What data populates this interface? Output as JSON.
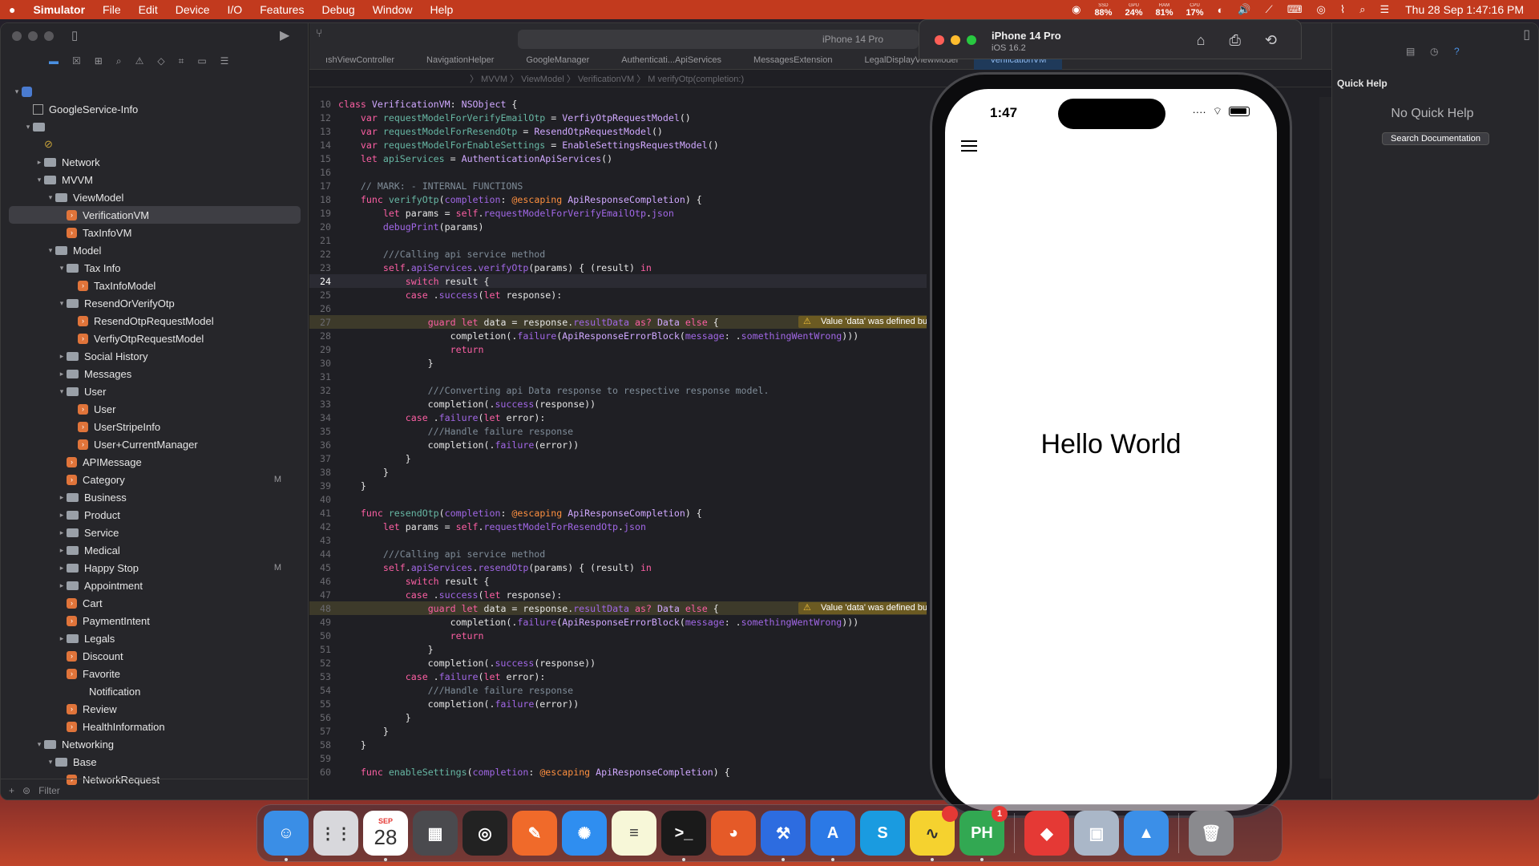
{
  "menubar": {
    "apple": "",
    "app": "Simulator",
    "items": [
      "File",
      "Edit",
      "Device",
      "I/O",
      "Features",
      "Debug",
      "Window",
      "Help"
    ],
    "stats": [
      {
        "label": "SSD",
        "value": "88%"
      },
      {
        "label": "GPU",
        "value": "24%"
      },
      {
        "label": "RAM",
        "value": "81%"
      },
      {
        "label": "CPU",
        "value": "17%"
      }
    ],
    "datetime": "Thu 28 Sep  1:47:16 PM"
  },
  "navigator": {
    "filter_placeholder": "Filter",
    "items": [
      {
        "label": "GoogleService-Info",
        "depth": 1,
        "kind": "plist"
      },
      {
        "label": "",
        "depth": 1,
        "kind": "folder",
        "open": true
      },
      {
        "label": "",
        "depth": 2,
        "kind": "other"
      },
      {
        "label": "Network",
        "depth": 2,
        "kind": "folder",
        "open": false
      },
      {
        "label": "MVVM",
        "depth": 2,
        "kind": "folder",
        "open": true
      },
      {
        "label": "ViewModel",
        "depth": 3,
        "kind": "folder",
        "open": true
      },
      {
        "label": "VerificationVM",
        "depth": 4,
        "kind": "swift",
        "selected": true
      },
      {
        "label": "TaxInfoVM",
        "depth": 4,
        "kind": "swift"
      },
      {
        "label": "Model",
        "depth": 3,
        "kind": "folder",
        "open": true
      },
      {
        "label": "Tax Info",
        "depth": 4,
        "kind": "folder",
        "open": true
      },
      {
        "label": "TaxInfoModel",
        "depth": 5,
        "kind": "swift"
      },
      {
        "label": "ResendOrVerifyOtp",
        "depth": 4,
        "kind": "folder",
        "open": true
      },
      {
        "label": "ResendOtpRequestModel",
        "depth": 5,
        "kind": "swift"
      },
      {
        "label": "VerfiyOtpRequestModel",
        "depth": 5,
        "kind": "swift"
      },
      {
        "label": "Social History",
        "depth": 4,
        "kind": "folder",
        "open": false
      },
      {
        "label": "Messages",
        "depth": 4,
        "kind": "folder",
        "open": false
      },
      {
        "label": "User",
        "depth": 4,
        "kind": "folder",
        "open": true
      },
      {
        "label": "User",
        "depth": 5,
        "kind": "swift"
      },
      {
        "label": "UserStripeInfo",
        "depth": 5,
        "kind": "swift"
      },
      {
        "label": "User+CurrentManager",
        "depth": 5,
        "kind": "swift"
      },
      {
        "label": "APIMessage",
        "depth": 4,
        "kind": "swift"
      },
      {
        "label": "Category",
        "depth": 4,
        "kind": "swift",
        "mark": "M"
      },
      {
        "label": "Business",
        "depth": 4,
        "kind": "folder",
        "open": false
      },
      {
        "label": "Product",
        "depth": 4,
        "kind": "folder",
        "open": false
      },
      {
        "label": "Service",
        "depth": 4,
        "kind": "folder",
        "open": false
      },
      {
        "label": "Medical",
        "depth": 4,
        "kind": "folder",
        "open": false
      },
      {
        "label": "Happy Stop",
        "depth": 4,
        "kind": "folder",
        "open": false,
        "mark": "M"
      },
      {
        "label": "Appointment",
        "depth": 4,
        "kind": "folder",
        "open": false
      },
      {
        "label": "Cart",
        "depth": 4,
        "kind": "swift"
      },
      {
        "label": "PaymentIntent",
        "depth": 4,
        "kind": "swift"
      },
      {
        "label": "Legals",
        "depth": 4,
        "kind": "folder",
        "open": false
      },
      {
        "label": "Discount",
        "depth": 4,
        "kind": "swift"
      },
      {
        "label": "Favorite",
        "depth": 4,
        "kind": "swift"
      },
      {
        "label": "Notification",
        "depth": 6,
        "kind": "none"
      },
      {
        "label": "Review",
        "depth": 4,
        "kind": "swift"
      },
      {
        "label": "HealthInformation",
        "depth": 4,
        "kind": "swift"
      },
      {
        "label": "Networking",
        "depth": 2,
        "kind": "folder",
        "open": true
      },
      {
        "label": "Base",
        "depth": 3,
        "kind": "folder",
        "open": true
      },
      {
        "label": "NetworkRequest",
        "depth": 4,
        "kind": "swift"
      }
    ]
  },
  "editor": {
    "scheme": "iPhone 14 Pro",
    "tabs": [
      "ıshViewController",
      "NavigationHelper",
      "GoogleManager",
      "Authenticati...ApiServices",
      "MessagesExtension",
      "LegalDisplayViewModel",
      "VerificationVM"
    ],
    "jumpbar": "〉 MVVM  〉 ViewModel  〉 VerificationVM  〉 M  verifyOtp(completion:)",
    "warning": "Value 'data' was defined but never used",
    "lines": [
      {
        "n": "10",
        "html": "<span class='kw'>class</span> <span class='ty'>VerificationVM</span><span class='pl'>: </span><span class='ty'>NSObject</span><span class='pl'> {</span>"
      },
      {
        "n": "12",
        "html": "<span class='pl'>    </span><span class='kw'>var</span><span class='pl'> </span><span class='id'>requestModelForVerifyEmailOtp</span><span class='pl'> = </span><span class='ty'>VerfiyOtpRequestModel</span><span class='pl'>()</span>"
      },
      {
        "n": "13",
        "html": "<span class='pl'>    </span><span class='kw'>var</span><span class='pl'> </span><span class='id'>requestModelForResendOtp</span><span class='pl'> = </span><span class='ty'>ResendOtpRequestModel</span><span class='pl'>()</span>"
      },
      {
        "n": "14",
        "html": "<span class='pl'>    </span><span class='kw'>var</span><span class='pl'> </span><span class='id'>requestModelForEnableSettings</span><span class='pl'> = </span><span class='ty'>EnableSettingsRequestModel</span><span class='pl'>()</span>"
      },
      {
        "n": "15",
        "html": "<span class='pl'>    </span><span class='kw'>let</span><span class='pl'> </span><span class='id'>apiServices</span><span class='pl'> = </span><span class='ty'>AuthenticationApiServices</span><span class='pl'>()</span>"
      },
      {
        "n": "16",
        "html": ""
      },
      {
        "n": "17",
        "html": "<span class='cm'>    // MARK: - INTERNAL FUNCTIONS</span>"
      },
      {
        "n": "18",
        "html": "<span class='pl'>    </span><span class='kw'>func</span><span class='pl'> </span><span class='id'>verifyOtp</span><span class='pl'>(</span><span class='fn'>completion</span><span class='pl'>: </span><span class='at'>@escaping</span><span class='pl'> </span><span class='ty'>ApiResponseCompletion</span><span class='pl'>) {</span>"
      },
      {
        "n": "19",
        "html": "<span class='pl'>        </span><span class='kw'>let</span><span class='pl'> params = </span><span class='kw'>self</span><span class='pl'>.</span><span class='fn'>requestModelForVerifyEmailOtp</span><span class='pl'>.</span><span class='fn'>json</span>"
      },
      {
        "n": "20",
        "html": "<span class='pl'>        </span><span class='fn'>debugPrint</span><span class='pl'>(params)</span>"
      },
      {
        "n": "21",
        "html": ""
      },
      {
        "n": "22",
        "html": "<span class='cm'>        ///Calling api service method</span>"
      },
      {
        "n": "23",
        "html": "<span class='pl'>        </span><span class='kw'>self</span><span class='pl'>.</span><span class='fn'>apiServices</span><span class='pl'>.</span><span class='fn'>verifyOtp</span><span class='pl'>(params) { (result) </span><span class='kw'>in</span>"
      },
      {
        "n": "24",
        "cur": true,
        "html": "<span class='pl'>            </span><span class='kw'>switch</span><span class='pl'> result {</span>"
      },
      {
        "n": "25",
        "html": "<span class='pl'>            </span><span class='kw'>case</span><span class='pl'> .</span><span class='fn'>success</span><span class='pl'>(</span><span class='kw'>let</span><span class='pl'> response):</span>"
      },
      {
        "n": "26",
        "html": ""
      },
      {
        "n": "27",
        "warn": true,
        "html": "<span class='pl'>                </span><span class='kw'>guard</span><span class='pl'> </span><span class='kw'>let</span><span class='pl'> data = response.</span><span class='fn'>resultData</span><span class='pl'> </span><span class='kw'>as?</span><span class='pl'> </span><span class='ty'>Data</span><span class='pl'> </span><span class='kw'>else</span><span class='pl'> {</span>"
      },
      {
        "n": "28",
        "html": "<span class='pl'>                    completion(.</span><span class='fn'>failure</span><span class='pl'>(</span><span class='ty'>ApiResponseErrorBlock</span><span class='pl'>(</span><span class='fn'>message</span><span class='pl'>: .</span><span class='fn'>somethingWentWrong</span><span class='pl'>)))</span>"
      },
      {
        "n": "29",
        "html": "<span class='pl'>                    </span><span class='kw'>return</span>"
      },
      {
        "n": "30",
        "html": "<span class='pl'>                }</span>"
      },
      {
        "n": "31",
        "html": ""
      },
      {
        "n": "32",
        "html": "<span class='cm'>                ///Converting api Data response to respective response model.</span>"
      },
      {
        "n": "33",
        "html": "<span class='pl'>                completion(.</span><span class='fn'>success</span><span class='pl'>(response))</span>"
      },
      {
        "n": "34",
        "html": "<span class='pl'>            </span><span class='kw'>case</span><span class='pl'> .</span><span class='fn'>failure</span><span class='pl'>(</span><span class='kw'>let</span><span class='pl'> error):</span>"
      },
      {
        "n": "35",
        "html": "<span class='cm'>                ///Handle failure response</span>"
      },
      {
        "n": "36",
        "html": "<span class='pl'>                completion(.</span><span class='fn'>failure</span><span class='pl'>(error))</span>"
      },
      {
        "n": "37",
        "html": "<span class='pl'>            }</span>"
      },
      {
        "n": "38",
        "html": "<span class='pl'>        }</span>"
      },
      {
        "n": "39",
        "html": "<span class='pl'>    }</span>"
      },
      {
        "n": "40",
        "html": ""
      },
      {
        "n": "41",
        "html": "<span class='pl'>    </span><span class='kw'>func</span><span class='pl'> </span><span class='id'>resendOtp</span><span class='pl'>(</span><span class='fn'>completion</span><span class='pl'>: </span><span class='at'>@escaping</span><span class='pl'> </span><span class='ty'>ApiResponseCompletion</span><span class='pl'>) {</span>"
      },
      {
        "n": "42",
        "html": "<span class='pl'>        </span><span class='kw'>let</span><span class='pl'> params = </span><span class='kw'>self</span><span class='pl'>.</span><span class='fn'>requestModelForResendOtp</span><span class='pl'>.</span><span class='fn'>json</span>"
      },
      {
        "n": "43",
        "html": ""
      },
      {
        "n": "44",
        "html": "<span class='cm'>        ///Calling api service method</span>"
      },
      {
        "n": "45",
        "html": "<span class='pl'>        </span><span class='kw'>self</span><span class='pl'>.</span><span class='fn'>apiServices</span><span class='pl'>.</span><span class='fn'>resendOtp</span><span class='pl'>(params) { (result) </span><span class='kw'>in</span>"
      },
      {
        "n": "46",
        "html": "<span class='pl'>            </span><span class='kw'>switch</span><span class='pl'> result {</span>"
      },
      {
        "n": "47",
        "html": "<span class='pl'>            </span><span class='kw'>case</span><span class='pl'> .</span><span class='fn'>success</span><span class='pl'>(</span><span class='kw'>let</span><span class='pl'> response):</span>"
      },
      {
        "n": "48",
        "warn": true,
        "html": "<span class='pl'>                </span><span class='kw'>guard</span><span class='pl'> </span><span class='kw'>let</span><span class='pl'> data = response.</span><span class='fn'>resultData</span><span class='pl'> </span><span class='kw'>as?</span><span class='pl'> </span><span class='ty'>Data</span><span class='pl'> </span><span class='kw'>else</span><span class='pl'> {</span>"
      },
      {
        "n": "49",
        "html": "<span class='pl'>                    completion(.</span><span class='fn'>failure</span><span class='pl'>(</span><span class='ty'>ApiResponseErrorBlock</span><span class='pl'>(</span><span class='fn'>message</span><span class='pl'>: .</span><span class='fn'>somethingWentWrong</span><span class='pl'>)))</span>"
      },
      {
        "n": "50",
        "html": "<span class='pl'>                    </span><span class='kw'>return</span>"
      },
      {
        "n": "51",
        "html": "<span class='pl'>                }</span>"
      },
      {
        "n": "52",
        "html": "<span class='pl'>                completion(.</span><span class='fn'>success</span><span class='pl'>(response))</span>"
      },
      {
        "n": "53",
        "html": "<span class='pl'>            </span><span class='kw'>case</span><span class='pl'> .</span><span class='fn'>failure</span><span class='pl'>(</span><span class='kw'>let</span><span class='pl'> error):</span>"
      },
      {
        "n": "54",
        "html": "<span class='cm'>                ///Handle failure response</span>"
      },
      {
        "n": "55",
        "html": "<span class='pl'>                completion(.</span><span class='fn'>failure</span><span class='pl'>(error))</span>"
      },
      {
        "n": "56",
        "html": "<span class='pl'>            }</span>"
      },
      {
        "n": "57",
        "html": "<span class='pl'>        }</span>"
      },
      {
        "n": "58",
        "html": "<span class='pl'>    }</span>"
      },
      {
        "n": "59",
        "html": ""
      },
      {
        "n": "60",
        "html": "<span class='pl'>    </span><span class='kw'>func</span><span class='pl'> </span><span class='id'>enableSettings</span><span class='pl'>(</span><span class='fn'>completion</span><span class='pl'>: </span><span class='at'>@escaping</span><span class='pl'> </span><span class='ty'>ApiResponseCompletion</span><span class='pl'>) {</span>"
      }
    ]
  },
  "inspector": {
    "title": "Quick Help",
    "empty": "No Quick Help",
    "search_button": "Search Documentation"
  },
  "simulator": {
    "device": "iPhone 14 Pro",
    "os": "iOS 16.2",
    "time": "1:47",
    "hello": "Hello World"
  },
  "dock": {
    "items": [
      {
        "name": "finder",
        "color": "#3a8ee6",
        "glyph": "☺"
      },
      {
        "name": "launchpad",
        "color": "#d8d8dc",
        "glyph": "⋮⋮"
      },
      {
        "name": "calendar",
        "color": "#ffffff",
        "glyph": "28"
      },
      {
        "name": "calculator",
        "color": "#4a4a4e",
        "glyph": "▦"
      },
      {
        "name": "quicktime",
        "color": "#222",
        "glyph": "◎"
      },
      {
        "name": "sketch-tool",
        "color": "#f06a2a",
        "glyph": "✎"
      },
      {
        "name": "safari",
        "color": "#2f8ef0",
        "glyph": "✺"
      },
      {
        "name": "notes",
        "color": "#f7f7d8",
        "glyph": "≡"
      },
      {
        "name": "terminal",
        "color": "#1a1a1a",
        "glyph": ">_"
      },
      {
        "name": "firefox",
        "color": "#e55a28",
        "glyph": "◕"
      },
      {
        "name": "xcode",
        "color": "#2d6ce0",
        "glyph": "⚒"
      },
      {
        "name": "appstore-tools",
        "color": "#2b79e6",
        "glyph": "A"
      },
      {
        "name": "skype",
        "color": "#1a9be0",
        "glyph": "S"
      },
      {
        "name": "monitor",
        "color": "#f5d22f",
        "glyph": "∿",
        "badge": ""
      },
      {
        "name": "producthunt",
        "color": "#32a852",
        "glyph": "PH",
        "badge": "1"
      },
      {
        "name": "anydesk",
        "color": "#e53935",
        "glyph": "◆"
      },
      {
        "name": "preview",
        "color": "#aab7c8",
        "glyph": "▣"
      },
      {
        "name": "keynote",
        "color": "#3b8fe8",
        "glyph": "▲"
      },
      {
        "name": "trash",
        "color": "#8a8a8e",
        "glyph": "🗑"
      }
    ],
    "calendar_month": "SEP",
    "calendar_day": "28"
  },
  "colors": {
    "menubar": "#c23a1e",
    "warning": "#f4c23a",
    "selection": "#3e3e44"
  }
}
